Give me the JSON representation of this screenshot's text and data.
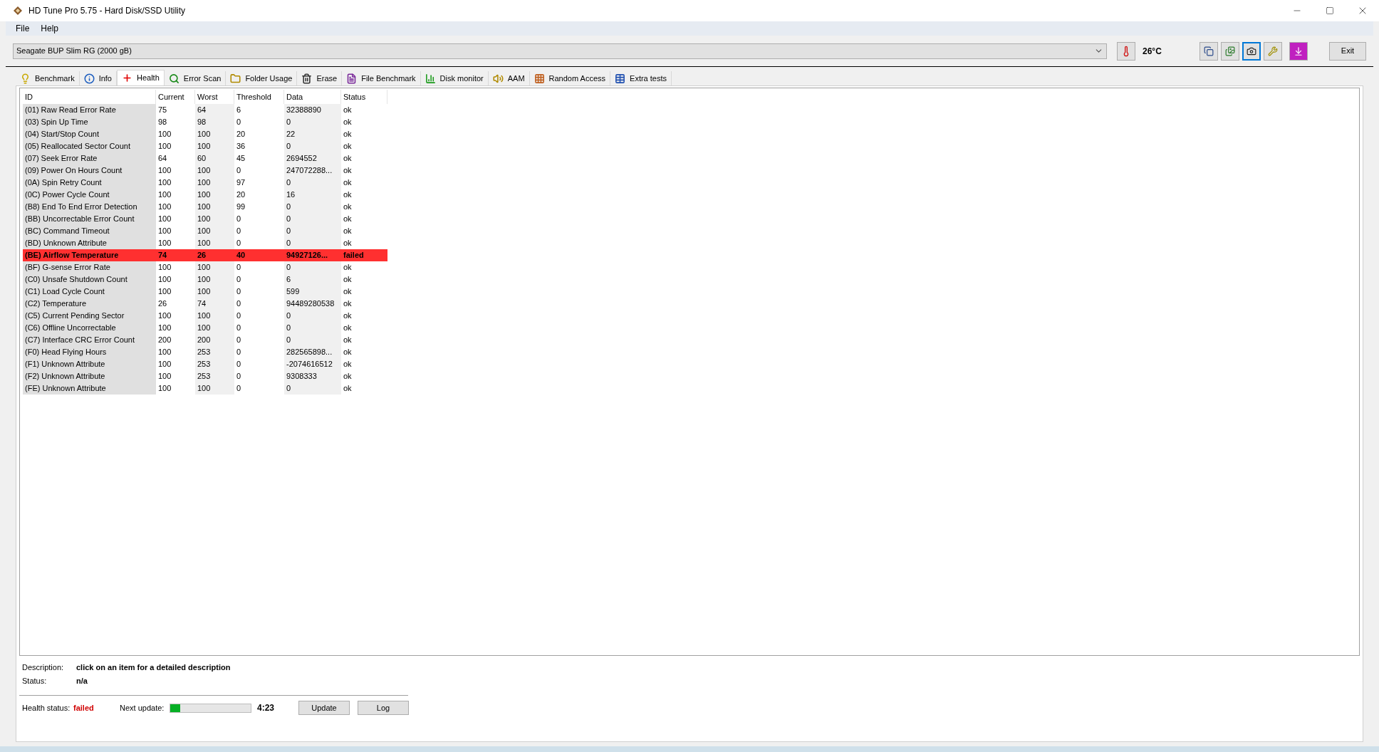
{
  "window": {
    "title": "HD Tune Pro 5.75 - Hard Disk/SSD Utility"
  },
  "menu": [
    {
      "label": "File"
    },
    {
      "label": "Help"
    }
  ],
  "drive": {
    "value": "Seagate BUP Slim RG (2000 gB)"
  },
  "temperature": "26°C",
  "toolbar": [
    {
      "kind": "copy",
      "focused": false
    },
    {
      "kind": "copy-image",
      "focused": false
    },
    {
      "kind": "camera",
      "focused": true
    },
    {
      "kind": "tool",
      "focused": false
    },
    {
      "kind": "save",
      "focused": false
    }
  ],
  "exit_button": "Exit",
  "tabs": [
    {
      "label": "Benchmark",
      "kind": "bulb",
      "selected": false
    },
    {
      "label": "Info",
      "kind": "info",
      "selected": false
    },
    {
      "label": "Health",
      "kind": "cross",
      "selected": true
    },
    {
      "label": "Error Scan",
      "kind": "search",
      "selected": false
    },
    {
      "label": "Folder Usage",
      "kind": "folder",
      "selected": false
    },
    {
      "label": "Erase",
      "kind": "trash",
      "selected": false
    },
    {
      "label": "File Benchmark",
      "kind": "file",
      "selected": false
    },
    {
      "label": "Disk monitor",
      "kind": "chart",
      "selected": false
    },
    {
      "label": "AAM",
      "kind": "speaker",
      "selected": false
    },
    {
      "label": "Random Access",
      "kind": "scatter",
      "selected": false
    },
    {
      "label": "Extra tests",
      "kind": "grid",
      "selected": false
    }
  ],
  "table": {
    "columns": [
      "ID",
      "Current",
      "Worst",
      "Threshold",
      "Data",
      "Status"
    ],
    "rows": [
      {
        "cells": [
          "(01) Raw Read Error Rate",
          "75",
          "64",
          "6",
          "32388890",
          "ok"
        ],
        "failed": false
      },
      {
        "cells": [
          "(03) Spin Up Time",
          "98",
          "98",
          "0",
          "0",
          "ok"
        ],
        "failed": false
      },
      {
        "cells": [
          "(04) Start/Stop Count",
          "100",
          "100",
          "20",
          "22",
          "ok"
        ],
        "failed": false
      },
      {
        "cells": [
          "(05) Reallocated Sector Count",
          "100",
          "100",
          "36",
          "0",
          "ok"
        ],
        "failed": false
      },
      {
        "cells": [
          "(07) Seek Error Rate",
          "64",
          "60",
          "45",
          "2694552",
          "ok"
        ],
        "failed": false
      },
      {
        "cells": [
          "(09) Power On Hours Count",
          "100",
          "100",
          "0",
          "247072288...",
          "ok"
        ],
        "failed": false
      },
      {
        "cells": [
          "(0A) Spin Retry Count",
          "100",
          "100",
          "97",
          "0",
          "ok"
        ],
        "failed": false
      },
      {
        "cells": [
          "(0C) Power Cycle Count",
          "100",
          "100",
          "20",
          "16",
          "ok"
        ],
        "failed": false
      },
      {
        "cells": [
          "(B8) End To End Error Detection",
          "100",
          "100",
          "99",
          "0",
          "ok"
        ],
        "failed": false
      },
      {
        "cells": [
          "(BB) Uncorrectable Error Count",
          "100",
          "100",
          "0",
          "0",
          "ok"
        ],
        "failed": false
      },
      {
        "cells": [
          "(BC) Command Timeout",
          "100",
          "100",
          "0",
          "0",
          "ok"
        ],
        "failed": false
      },
      {
        "cells": [
          "(BD) Unknown Attribute",
          "100",
          "100",
          "0",
          "0",
          "ok"
        ],
        "failed": false
      },
      {
        "cells": [
          "(BE) Airflow Temperature",
          "74",
          "26",
          "40",
          "94927126...",
          "failed"
        ],
        "failed": true
      },
      {
        "cells": [
          "(BF) G-sense Error Rate",
          "100",
          "100",
          "0",
          "0",
          "ok"
        ],
        "failed": false
      },
      {
        "cells": [
          "(C0) Unsafe Shutdown Count",
          "100",
          "100",
          "0",
          "6",
          "ok"
        ],
        "failed": false
      },
      {
        "cells": [
          "(C1) Load Cycle Count",
          "100",
          "100",
          "0",
          "599",
          "ok"
        ],
        "failed": false
      },
      {
        "cells": [
          "(C2) Temperature",
          "26",
          "74",
          "0",
          "94489280538",
          "ok"
        ],
        "failed": false
      },
      {
        "cells": [
          "(C5) Current Pending Sector",
          "100",
          "100",
          "0",
          "0",
          "ok"
        ],
        "failed": false
      },
      {
        "cells": [
          "(C6) Offline Uncorrectable",
          "100",
          "100",
          "0",
          "0",
          "ok"
        ],
        "failed": false
      },
      {
        "cells": [
          "(C7) Interface CRC Error Count",
          "200",
          "200",
          "0",
          "0",
          "ok"
        ],
        "failed": false
      },
      {
        "cells": [
          "(F0) Head Flying Hours",
          "100",
          "253",
          "0",
          "282565898...",
          "ok"
        ],
        "failed": false
      },
      {
        "cells": [
          "(F1) Unknown Attribute",
          "100",
          "253",
          "0",
          "-2074616512",
          "ok"
        ],
        "failed": false
      },
      {
        "cells": [
          "(F2) Unknown Attribute",
          "100",
          "253",
          "0",
          "9308333",
          "ok"
        ],
        "failed": false
      },
      {
        "cells": [
          "(FE) Unknown Attribute",
          "100",
          "100",
          "0",
          "0",
          "ok"
        ],
        "failed": false
      }
    ]
  },
  "details": [
    {
      "label": "Description:",
      "value": "click on an item for a detailed description"
    },
    {
      "label": "Status:",
      "value": "n/a"
    }
  ],
  "health": {
    "label": "Health status:",
    "value": "failed",
    "failed": true
  },
  "next_update": {
    "label": "Next update:",
    "level": 0.12,
    "time": "4:23"
  },
  "buttons": [
    "Update",
    "Log"
  ]
}
